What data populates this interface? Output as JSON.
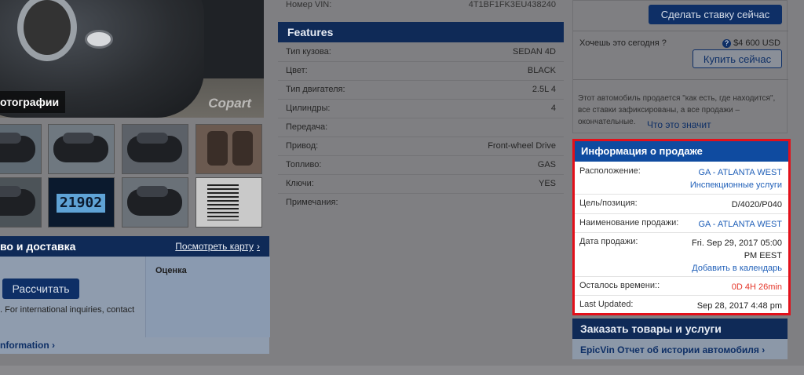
{
  "photos": {
    "label": "отографии",
    "watermark": "Copart",
    "odometer": "21902"
  },
  "shipping": {
    "title": "во и доставка",
    "map_link": "Посмотреть карту",
    "calc_button": "Рассчитать",
    "estimate_label": "Оценка",
    "note": ". For international inquiries, contact",
    "info_link": "nformation"
  },
  "vin": {
    "label": "Номер VIN:",
    "value": "4T1BF1FK3EU438240"
  },
  "features": {
    "title": "Features",
    "rows": [
      {
        "label": "Тип кузова:",
        "value": "SEDAN 4D"
      },
      {
        "label": "Цвет:",
        "value": "BLACK"
      },
      {
        "label": "Тип двигателя:",
        "value": "2.5L 4"
      },
      {
        "label": "Цилиндры:",
        "value": "4"
      },
      {
        "label": "Передача:",
        "value": ""
      },
      {
        "label": "Привод:",
        "value": "Front-wheel Drive"
      },
      {
        "label": "Топливо:",
        "value": "GAS"
      },
      {
        "label": "Ключи:",
        "value": "YES"
      },
      {
        "label": "Примечания:",
        "value": ""
      }
    ]
  },
  "bid": {
    "bid_button": "Сделать ставку сейчас",
    "want_today": "Хочешь это сегодня ?",
    "price": "$4 600 USD",
    "buy_button": "Купить сейчас",
    "as_is": "Этот автомобиль продается \"как есть, где находится\", все ставки зафиксированы, а все продажи – окончательные.",
    "what_link": "Что это значит"
  },
  "sale_info": {
    "title": "Информация о продаже",
    "location_label": "Расположение:",
    "location_value": "GA - ATLANTA WEST",
    "inspection_link": "Инспекционные услуги",
    "lane_label": "Цель/позиция:",
    "lane_value": "D/4020/P040",
    "sale_name_label": "Наименование продажи:",
    "sale_name_value": "GA - ATLANTA WEST",
    "date_label": "Дата продажи:",
    "date_value_1": "Fri. Sep 29, 2017 05:00",
    "date_value_2": "PM EEST",
    "calendar_link": "Добавить в календарь",
    "time_left_label": "Осталось времени::",
    "time_left_value": "0D 4H 26min",
    "updated_label": "Last Updated:",
    "updated_value": "Sep 28, 2017 4:48 pm"
  },
  "order": {
    "title": "Заказать товары и услуги",
    "link": "EpicVin Отчет об истории автомобиля"
  },
  "icons": {
    "help": "question-circle-icon",
    "chevron": "chevron-right-icon"
  },
  "colors": {
    "header_navy": "#0f2a57",
    "sale_header_blue": "#0f4ba0",
    "highlight_red": "#e3101a",
    "link_blue": "#1f5fb8",
    "time_red": "#e5372a"
  }
}
